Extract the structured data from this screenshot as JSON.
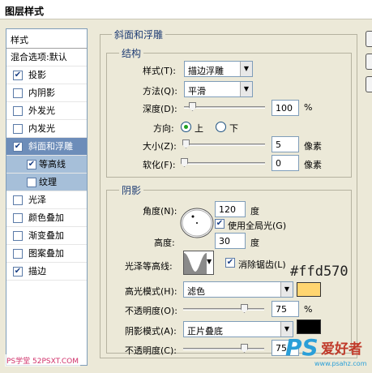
{
  "window": {
    "title": "图层样式"
  },
  "sidebar": {
    "header": "样式",
    "blend_options": "混合选项:默认",
    "items": [
      {
        "label": "投影",
        "checked": true
      },
      {
        "label": "内阴影",
        "checked": false
      },
      {
        "label": "外发光",
        "checked": false
      },
      {
        "label": "内发光",
        "checked": false
      },
      {
        "label": "斜面和浮雕",
        "checked": true,
        "selected": true
      },
      {
        "label": "等高线",
        "checked": true,
        "sub": true
      },
      {
        "label": "纹理",
        "checked": false,
        "sub": true
      },
      {
        "label": "光泽",
        "checked": false
      },
      {
        "label": "颜色叠加",
        "checked": false
      },
      {
        "label": "渐变叠加",
        "checked": false
      },
      {
        "label": "图案叠加",
        "checked": false
      },
      {
        "label": "描边",
        "checked": true
      }
    ]
  },
  "bevel": {
    "title": "斜面和浮雕",
    "structure": {
      "title": "结构",
      "style_label": "样式(T):",
      "style_value": "描边浮雕",
      "technique_label": "方法(Q):",
      "technique_value": "平滑",
      "depth_label": "深度(D):",
      "depth_value": "100",
      "depth_unit": "%",
      "depth_level": 0.1,
      "direction_label": "方向:",
      "direction_up": "上",
      "direction_down": "下",
      "direction_selected": "up",
      "size_label": "大小(Z):",
      "size_value": "5",
      "size_unit": "像素",
      "size_level": 0.02,
      "soften_label": "软化(F):",
      "soften_value": "0",
      "soften_unit": "像素",
      "soften_level": 0.0
    },
    "shading": {
      "title": "阴影",
      "angle_label": "角度(N):",
      "angle_value": "120",
      "degree_unit": "度",
      "global_light_label": "使用全局光(G)",
      "global_light_checked": true,
      "altitude_label": "高度:",
      "altitude_value": "30",
      "gloss_contour_label": "光泽等高线:",
      "anti_aliased_label": "消除锯齿(L)",
      "anti_aliased_checked": true,
      "highlight_mode_label": "高光模式(H):",
      "highlight_mode_value": "滤色",
      "highlight_color": "#ffd570",
      "highlight_color_text": "#ffd570",
      "highlight_opacity_label": "不透明度(O):",
      "highlight_opacity_value": "75",
      "highlight_opacity_level": 0.75,
      "shadow_mode_label": "阴影模式(A):",
      "shadow_mode_value": "正片叠底",
      "shadow_color": "#000000",
      "shadow_opacity_label": "不透明度(C):",
      "shadow_opacity_value": "75",
      "shadow_opacity_level": 0.75,
      "percent_unit": "%"
    }
  },
  "watermarks": {
    "bottom_left": "PS学堂 52PSXT.COM",
    "bottom_right_logo": "PS",
    "bottom_right_text": "爱好者",
    "bottom_right_url": "www.psahz.com"
  }
}
